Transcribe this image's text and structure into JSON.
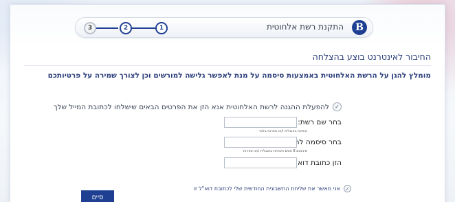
{
  "header": {
    "title": "התקנת רשת אלחוטית",
    "logo_letter": "B",
    "steps": [
      "3",
      "2",
      "1"
    ]
  },
  "main": {
    "subtitle": "החיבור לאינטרנט בוצע בהצלחה",
    "recommendation": "מומלץ להגן על הרשת האלחוטית באמצעות סיסמה על מנת לאפשר גלישה למורשים וכן לצורך שמירה על פרטיותכם",
    "instruction": "להפעלת ההגנה לרשת האלחוטית אנא הזן את הפרטים הבאים שישלחו לכתובת המייל שלך"
  },
  "form": {
    "network_name": {
      "label": "בחר שם רשת:",
      "value": "",
      "hint": "אותיות באנגלית ו/או ספרות בלבד"
    },
    "password": {
      "label": "בחר סיסמה לרשת:",
      "value": "",
      "hint": "מינימום 8 תווים ואותיות באנגלית ו/או ספרות"
    },
    "email": {
      "label": "הזן כתובת דוא\"ל",
      "value": ""
    }
  },
  "consent": {
    "label": "אני מאשר את שליחת החשבונית החודשית שלי לכתובת דוא\"ל זו"
  },
  "actions": {
    "finish_label": "סיים"
  },
  "colors": {
    "brand": "#1f3f93",
    "accent_text": "#2b3e7a"
  }
}
